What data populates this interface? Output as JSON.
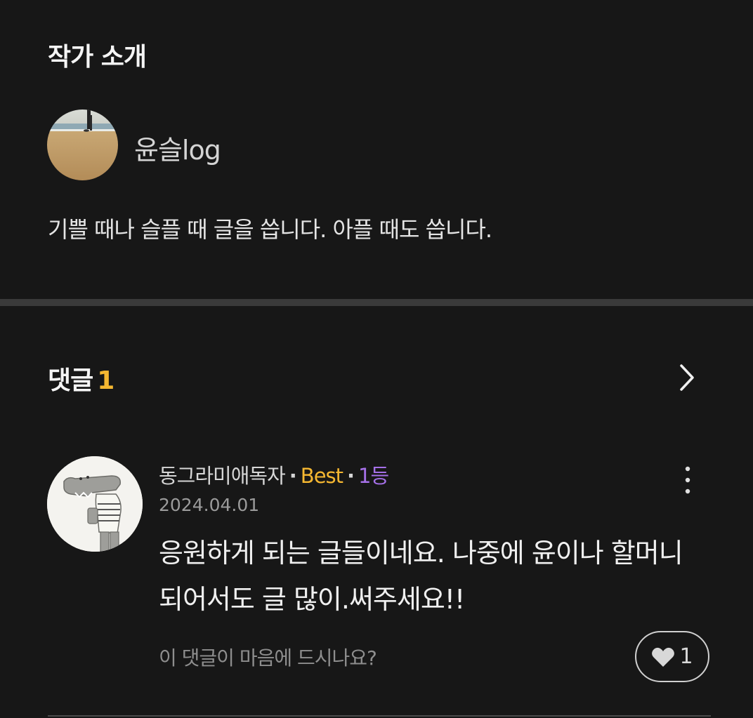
{
  "author_section": {
    "title": "작가 소개",
    "author_name": "윤슬log",
    "bio": "기쁠 때나 슬플 때 글을 씁니다. 아플 때도 씁니다."
  },
  "comments_section": {
    "title": "댓글",
    "count": "1",
    "comments": [
      {
        "author": "동그라미애독자",
        "best_label": "Best",
        "rank_label": "1등",
        "date": "2024.04.01",
        "text": "응원하게 되는 글들이네요. 나중에 윤이나 할머니 되어서도 글 많이.써주세요!!",
        "like_prompt": "이 댓글이 마음에 드시나요?",
        "like_count": "1"
      }
    ]
  },
  "icons": {
    "chevron": "chevron-right-icon",
    "more": "more-vertical-icon",
    "heart": "heart-icon"
  },
  "colors": {
    "background": "#171717",
    "accent_best": "#f5b731",
    "accent_rank": "#a570e8",
    "divider": "#3a3a3a"
  }
}
